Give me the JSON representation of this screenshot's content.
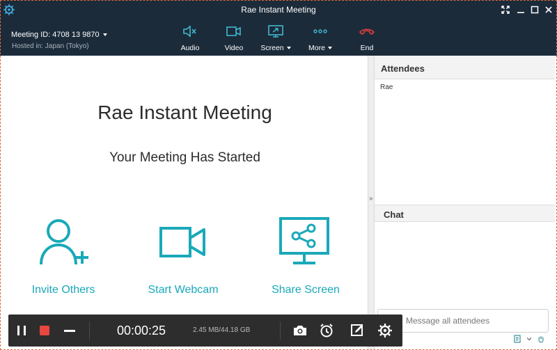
{
  "window": {
    "title": "Rae Instant Meeting",
    "controls": [
      "fullscreen-icon",
      "minimize-icon",
      "maximize-icon",
      "close-icon"
    ]
  },
  "toolbar": {
    "meeting_id": "Meeting ID:  4708 13 9870",
    "hosted_in": "Hosted in: Japan (Tokyo)",
    "tools": [
      {
        "label": "Audio",
        "icon": "muted-speaker-icon"
      },
      {
        "label": "Video",
        "icon": "video-camera-icon"
      },
      {
        "label": "Screen",
        "icon": "screen-share-icon"
      },
      {
        "label": "More",
        "icon": "more-dots-icon"
      },
      {
        "label": "End",
        "icon": "end-call-icon"
      }
    ],
    "end_color": "#e0403a"
  },
  "main": {
    "title": "Rae Instant Meeting",
    "subtitle": "Your Meeting Has Started",
    "actions": [
      {
        "label": "Invite Others",
        "icon": "add-user-icon"
      },
      {
        "label": "Start Webcam",
        "icon": "webcam-icon"
      },
      {
        "label": "Share Screen",
        "icon": "share-screen-icon"
      }
    ],
    "accent": "#19a9b9"
  },
  "sidebar": {
    "toggle": "»",
    "attendees": {
      "header": "Attendees",
      "list": [
        "Rae"
      ]
    },
    "chat": {
      "header": "Chat",
      "placeholder": "Message all attendees"
    }
  },
  "recorder": {
    "timer": "00:00:25",
    "storage": "2.45 MB/44.18 GB",
    "buttons": [
      "pause-icon",
      "stop-record-icon",
      "collapse-icon",
      "screenshot-icon",
      "schedule-clock-icon",
      "annotate-icon",
      "settings-icon"
    ],
    "stop_color": "#e8463f"
  }
}
